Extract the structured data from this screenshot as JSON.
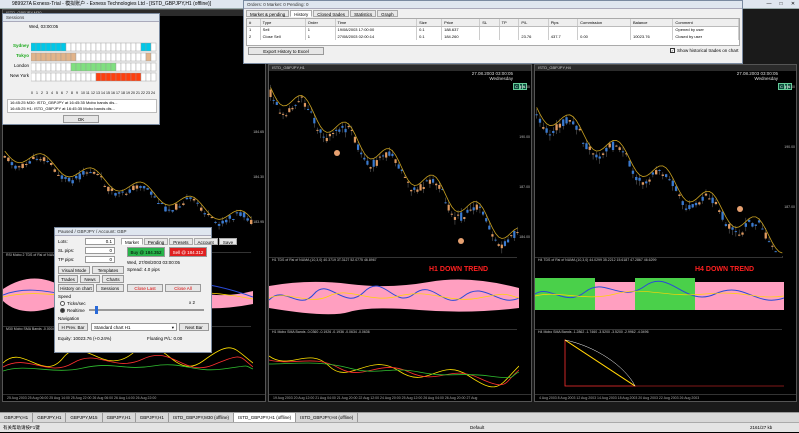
{
  "window": {
    "title": "989927A Exness-Trial - 模拟账户 - Exness Technologies Ltd - [ISTD_GBPJPY,H1 (offline)]"
  },
  "sessions": {
    "title": "Sessions",
    "date_label": "Wed, 03:00:05",
    "rows": [
      "Sydney",
      "Tokyo",
      "London",
      "New York"
    ],
    "hours": [
      "0",
      "1",
      "2",
      "3",
      "4",
      "5",
      "6",
      "7",
      "8",
      "9",
      "10",
      "11",
      "12",
      "13",
      "14",
      "15",
      "16",
      "17",
      "18",
      "19",
      "20",
      "21",
      "22",
      "23",
      "24"
    ],
    "messages": [
      "16:45:25  M30: ISTD_GBPJPY at 16:45:35 Mobo bands dis...",
      "16:45:25  H1: ISTD_GBPJPY at 16:45:35 Mobo bands dis..."
    ],
    "ok_label": "OK",
    "colors": {
      "sydney": "#00c8e8",
      "tokyo": "#e2b48a",
      "london": "#7fe07f",
      "newyork": "#ff4010"
    }
  },
  "orders": {
    "title": "Orders: 0      Market: 0      Pending: 0",
    "tabs": [
      "Market & pending",
      "History",
      "Closed trades",
      "Statistics",
      "Graph"
    ],
    "active_tab": "History",
    "columns": [
      "#",
      "Type",
      "Order",
      "Time",
      "Size",
      "Price",
      "SL",
      "TP",
      "P/L",
      "Pips",
      "Commission",
      "Balance",
      "Comment"
    ],
    "rows": [
      [
        "1",
        "Sell",
        "1",
        "19/08/2003 17:00:00",
        "0.1",
        "188.637",
        "",
        "",
        "",
        "",
        "",
        "",
        "Opened by user"
      ],
      [
        "2",
        "Close Sell",
        "1",
        "27/08/2003 02:00:14",
        "0.1",
        "184.260",
        "",
        "",
        "23.76",
        "437.7",
        "0.00",
        "10023.76",
        "Closed by user"
      ]
    ],
    "export_label": "Export History to Excel",
    "show_hist_label": "Show historical trades on chart"
  },
  "charts": {
    "left": {
      "title": "ISTD_GBPJPY,M30",
      "trend": "",
      "ind1": "RSI Mobo 2 TDS of Rsi of NUMA (10,3,0) (3,5,6) RSI...",
      "ind2": "M30 Mobo SMA Bands -0.00048 -0.00120...",
      "dates": "25 Aug 2003   25 Aug 06:00   25 Aug 14:00   25 Aug 22:00   26 Aug 06:00   26 Aug 14:00   26 Aug 22:00"
    },
    "mid": {
      "title": "ISTD_GBPJPY,H1",
      "date": "27.08.2003  03:00:05",
      "day": "Wednesday",
      "trend": "H1 DOWN TREND",
      "ind1": "H1 TDS of Rsi of NUMA (10,3,0) 40.3719 3T.3127 52.0775 46.8967",
      "ind2": "H1 Mobo SMA Bands -0.0360 -0.1926 -0.1936 -0.0634 -0.0636",
      "dates": "19 Aug 2003   20 Aug 12:00   21 Aug 04:00   21 Aug 20:00   22 Aug 12:00   24 Aug 20:00   25 Aug 12:00   26 Aug 04:00   26 Aug 20:00   27 Aug"
    },
    "right": {
      "title": "ISTD_GBPJPY,H4",
      "date": "27.08.2003  03:00:05",
      "day": "Wednesday",
      "trend": "H4 DOWN TREND",
      "ind1": "H4 TDS of Rsi of NUMA (10,3,0) 44.0299 35.2212 15.6187 47.2867 46.6299",
      "ind2": "H4 Mobo SMA Bands -1.2862 -1.7460 -3.5200 -3.5200 -2.9962 -4.0496",
      "dates": "4 Aug 2003   8 Aug 2003   12 Aug 2003   14 Aug 2003   18 Aug 2003   20 Aug 2003   22 Aug 2003   26 Aug 2003"
    },
    "buttons": [
      "H",
      "News",
      "Obj",
      "P",
      "C"
    ]
  },
  "account": {
    "title": "Paused / GBPJPY / Account: GBP",
    "lots_label": "Lots:",
    "lots_value": "0.1",
    "sl_label": "SL pips:",
    "sl_value": "0",
    "tp_label": "TP pips:",
    "tp_value": "0",
    "tabs": [
      "Market",
      "Pending",
      "Presets",
      "Account",
      "Save"
    ],
    "buy_label": "Buy @ 184.352",
    "sell_label": "Sell @ 184.312",
    "time_text": "Wed, 27/08/2003 03:00:05",
    "spread_text": "Spread: 4.0 pips",
    "left_buttons": [
      "Visual Mode",
      "Templates",
      "Trades",
      "News",
      "Charts",
      "History on chart",
      "Sessions"
    ],
    "close_last": "Close Last",
    "close_all": "Close All",
    "speed_label": "Speed",
    "ticks_label": "Ticks/sec",
    "realtime_label": "Realtime",
    "speed_value": "x 2",
    "nav_label": "Navigation",
    "prev_bar": "H Prev. Bar",
    "chart_type": "Standard chart  H1",
    "next_bar": "Next Bar",
    "equity_label": "Equity: 10023.76 (+0.24%)",
    "floating_label": "Floating P/L: 0.00"
  },
  "chart_tabs": [
    "GBPJPY,H1",
    "GBPJPY,H1",
    "GBPJPY,M15",
    "GBPJPY,H1",
    "GBPJPY,H1",
    "ISTD_GBPJPY,M30 (offline)",
    "ISTD_GBPJPY,H1 (offline)",
    "ISTD_GBPJPY,H4 (offline)"
  ],
  "active_chart_tab": 6,
  "status": {
    "help": "有关帮助请按F1键",
    "profile": "Default",
    "traffic": "2161/27 kb"
  }
}
